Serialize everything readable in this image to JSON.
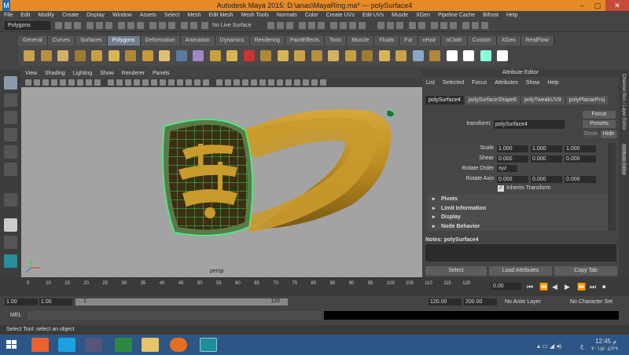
{
  "window": {
    "title": "Autodesk Maya 2015: D:\\anas\\MayaRing.ma*   ---   polySurface4"
  },
  "menus": [
    "File",
    "Edit",
    "Modify",
    "Create",
    "Display",
    "Window",
    "Assets",
    "Select",
    "Mesh",
    "Edit Mesh",
    "Mesh Tools",
    "Normals",
    "Color",
    "Create UVs",
    "Edit UVs",
    "Musde",
    "XGen",
    "Pipeline Cache",
    "Bifrost",
    "Help"
  ],
  "status": {
    "mode": "Polygons",
    "live_surface": "No Live Surface"
  },
  "shelf_tabs": [
    "General",
    "Curves",
    "Surfaces",
    "Polygons",
    "Deformation",
    "Animation",
    "Dynamics",
    "Rendering",
    "PaintEffects",
    "Toon",
    "Muscle",
    "Fluids",
    "Fur",
    "nHair",
    "nCloth",
    "Custom",
    "XGen",
    "RealFlow"
  ],
  "shelf_active": "Polygons",
  "viewport": {
    "menus": [
      "View",
      "Shading",
      "Lighting",
      "Show",
      "Renderer",
      "Panels"
    ],
    "camera": "persp"
  },
  "attr_editor": {
    "title": "Attribute Editor",
    "menus": [
      "List",
      "Selected",
      "Focus",
      "Attributes",
      "Show",
      "Help"
    ],
    "tabs": [
      "polySurface4",
      "polySurfaceShape6",
      "polyTweakUV9",
      "polyPlanarProj"
    ],
    "transform_label": "transform:",
    "transform_value": "polySurface4",
    "focus_btn": "Focus",
    "presets_btn": "Presets",
    "show_btn": "Show",
    "hide_btn": "Hide",
    "scale_label": "Scale",
    "scale": [
      "1.000",
      "1.000",
      "1.000"
    ],
    "shear_label": "Shear",
    "shear": [
      "0.000",
      "0.000",
      "0.000"
    ],
    "rotate_order_label": "Rotate Order",
    "rotate_order": "xyz",
    "rotate_axis_label": "Rotate Axis",
    "rotate_axis": [
      "0.000",
      "0.000",
      "0.000"
    ],
    "inherits_label": "Inherits Transform",
    "sections": [
      "Pivots",
      "Limit Information",
      "Display",
      "Node Behavior"
    ],
    "notes": "Notes: polySurface4",
    "select_btn": "Select",
    "load_btn": "Load Attributes",
    "copy_btn": "Copy Tab"
  },
  "side_tabs": [
    "Channel Box / Layer Editor",
    "Attribute Editor"
  ],
  "timeline": {
    "ticks": [
      "5",
      "10",
      "15",
      "20",
      "25",
      "30",
      "35",
      "40",
      "45",
      "50",
      "55",
      "60",
      "65",
      "70",
      "75",
      "80",
      "85",
      "90",
      "95",
      "100",
      "105",
      "110",
      "115",
      "120"
    ],
    "current": "0.00"
  },
  "range": {
    "start": "1.00",
    "start2": "1.00",
    "slider_start": "1",
    "slider_end": "120",
    "end": "120.00",
    "end2": "200.00",
    "anim_layer": "No Anim Layer",
    "char_set": "No Character Set"
  },
  "mel": {
    "label": "MEL"
  },
  "help": "Select Tool: select an object",
  "taskbar": {
    "time": "12:45 م",
    "date": "٢٠١٥/٠٤/٢٩",
    "lang": "ع"
  }
}
